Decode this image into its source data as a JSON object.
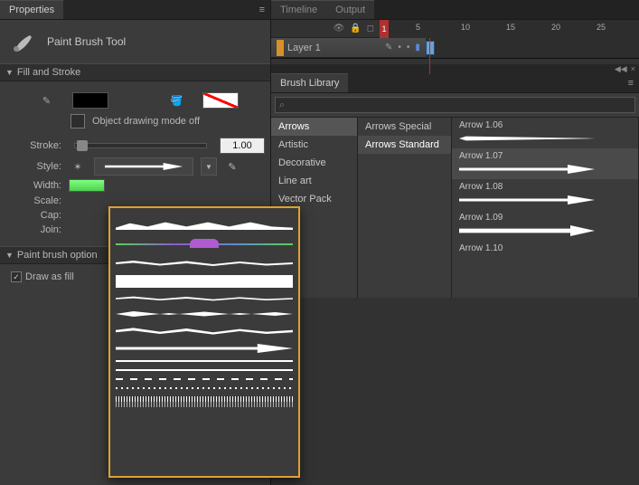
{
  "properties": {
    "tab": "Properties",
    "tool_name": "Paint Brush Tool"
  },
  "fill_stroke": {
    "title": "Fill and Stroke",
    "mode_label": "Object drawing mode off",
    "stroke_label": "Stroke:",
    "stroke_value": "1.00",
    "style_label": "Style:",
    "width_label": "Width:",
    "scale_label": "Scale:",
    "cap_label": "Cap:",
    "join_label": "Join:"
  },
  "paint_options": {
    "title": "Paint brush option",
    "draw_as_fill": "Draw as fill"
  },
  "timeline": {
    "tabs": [
      "Timeline",
      "Output"
    ],
    "layer_name": "Layer 1",
    "ticks": [
      "1",
      "5",
      "10",
      "15",
      "20",
      "25"
    ]
  },
  "brush_library": {
    "tab": "Brush Library",
    "search_placeholder": "",
    "search_icon": "⌕",
    "categories": [
      "Arrows",
      "Artistic",
      "Decorative",
      "Line art",
      "Vector Pack"
    ],
    "subcats": [
      "Arrows Special",
      "Arrows Standard"
    ],
    "arrows": [
      "Arrow 1.06",
      "Arrow 1.07",
      "Arrow 1.08",
      "Arrow 1.09",
      "Arrow 1.10"
    ]
  },
  "handle": {
    "collapse": "◀◀",
    "close": "×"
  }
}
